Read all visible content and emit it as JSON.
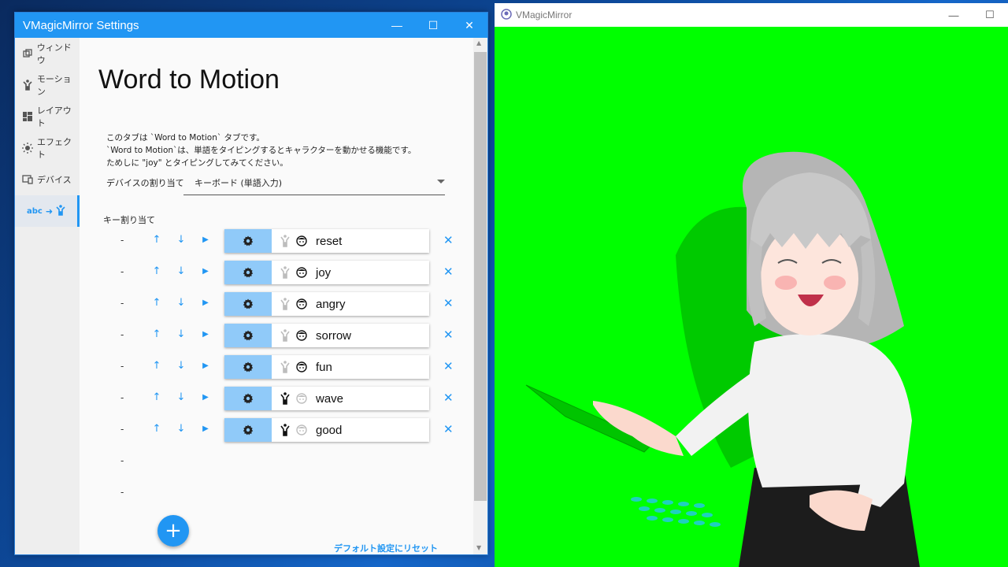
{
  "settings_window": {
    "title": "VMagicMirror Settings",
    "controls": {
      "minimize": "—",
      "maximize": "☐",
      "close": "✕"
    }
  },
  "sidebar": {
    "items": [
      {
        "label": "ウィンドウ",
        "icon": "window-icon"
      },
      {
        "label": "モーション",
        "icon": "motion-icon"
      },
      {
        "label": "レイアウト",
        "icon": "layout-icon"
      },
      {
        "label": "エフェクト",
        "icon": "effect-icon"
      },
      {
        "label": "デバイス",
        "icon": "device-icon"
      },
      {
        "label": "abc",
        "icon": "word-to-motion-icon",
        "active": true
      }
    ]
  },
  "main": {
    "page_title": "Word to Motion",
    "description": [
      "このタブは `Word to Motion` タブです。",
      "`Word to Motion`は、単語をタイピングするとキャラクターを動かせる機能です。",
      "ためしに \"joy\" とタイピングしてみてください。"
    ],
    "device_label": "デバイスの割り当て",
    "device_value": "キーボード (単語入力)",
    "key_assign_label": "キー割り当て",
    "rows": [
      {
        "dash": "-",
        "word": "reset",
        "motion_active": false,
        "face_active": true
      },
      {
        "dash": "-",
        "word": "joy",
        "motion_active": false,
        "face_active": true
      },
      {
        "dash": "-",
        "word": "angry",
        "motion_active": false,
        "face_active": true
      },
      {
        "dash": "-",
        "word": "sorrow",
        "motion_active": false,
        "face_active": true
      },
      {
        "dash": "-",
        "word": "fun",
        "motion_active": false,
        "face_active": true
      },
      {
        "dash": "-",
        "word": "wave",
        "motion_active": true,
        "face_active": false
      },
      {
        "dash": "-",
        "word": "good",
        "motion_active": true,
        "face_active": false
      }
    ],
    "extra_dashes": [
      "-",
      "-"
    ],
    "arrow_up": "↑",
    "arrow_down": "↓",
    "play": "▶",
    "delete": "✕",
    "add_button": "+",
    "reset_link": "デフォルト設定にリセット"
  },
  "vmm_window": {
    "title": "VMagicMirror",
    "controls": {
      "minimize": "—",
      "maximize": "☐"
    },
    "background_color": "#00ff00"
  },
  "colors": {
    "accent": "#2196f3",
    "gear_tile": "#90caf9"
  }
}
